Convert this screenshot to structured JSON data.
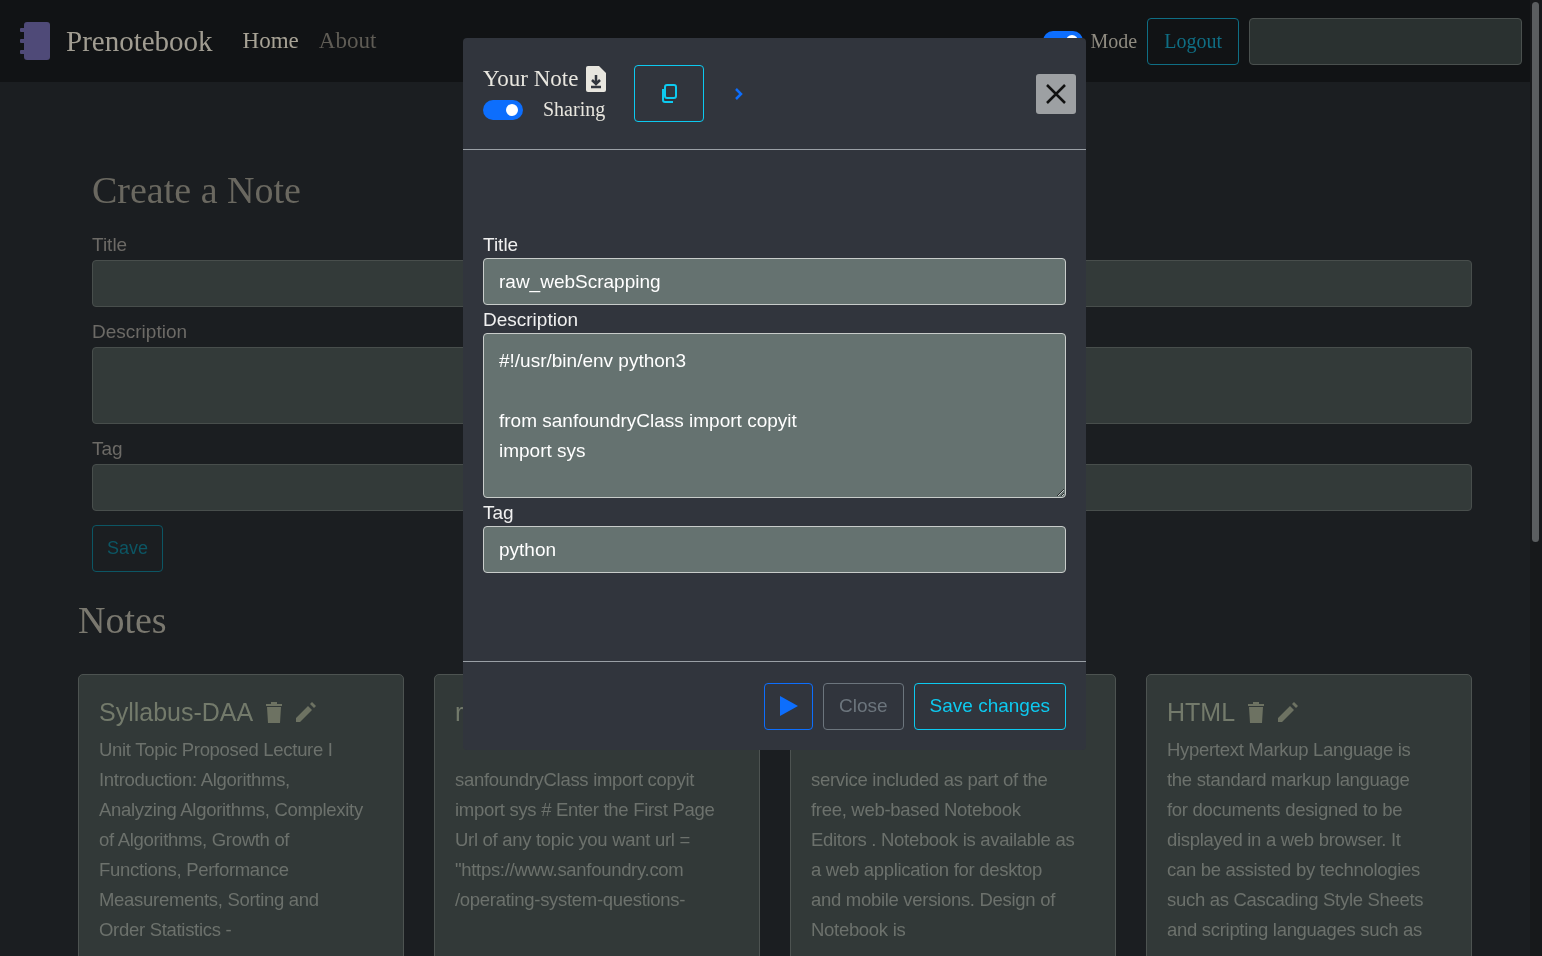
{
  "navbar": {
    "brand": "Prenotebook",
    "links": [
      {
        "label": "Home",
        "selected": true
      },
      {
        "label": "About",
        "selected": false
      }
    ],
    "theme_toggle": {
      "on": true,
      "label": "Mode"
    },
    "logout": "Logout"
  },
  "form": {
    "title": "Create a Note",
    "fields": [
      {
        "label": "Title",
        "kind": "input"
      },
      {
        "label": "Description",
        "kind": "textarea"
      },
      {
        "label": "Tag",
        "kind": "input"
      }
    ],
    "save": "Save"
  },
  "notes_heading": "Notes",
  "notes": [
    {
      "kind": "full",
      "title": "Syllabus-DAA",
      "description": "Unit Topic Proposed Lecture I Introduction: Algorithms, Analyzing Algorithms, Complexity of Algorithms, Growth of Functions, Performance Measurements, Sorting and Order Statistics -"
    },
    {
      "kind": "covered",
      "title": "r",
      "description": "sanfoundryClass import copyit import sys # Enter the First Page Url of any topic you want url = \"https://www.sanfoundry.com /operating-system-questions-"
    },
    {
      "kind": "covered",
      "description": "service included as part of the free, web-based Notebook Editors . Notebook is available as a web application for desktop and mobile versions. Design of Notebook is"
    },
    {
      "kind": "full",
      "title": "HTML",
      "description": "Hypertext Markup Language is the standard markup language for documents designed to be displayed in a web browser. It can be assisted by technologies such as Cascading Style Sheets and scripting languages such as"
    }
  ],
  "modal": {
    "title": "Your Note",
    "sharing": {
      "label": "Sharing",
      "on": true
    },
    "fields": [
      {
        "label": "Title",
        "kind": "input",
        "value": "raw_webScrapping"
      },
      {
        "label": "Description",
        "kind": "textarea",
        "value": "#!/usr/bin/env python3\n\nfrom sanfoundryClass import copyit\nimport sys"
      },
      {
        "label": "Tag",
        "kind": "input",
        "value": "python"
      }
    ],
    "buttons": [
      {
        "label": "Close",
        "kind": "secondary"
      },
      {
        "label": "Save changes",
        "kind": "primary"
      }
    ]
  }
}
